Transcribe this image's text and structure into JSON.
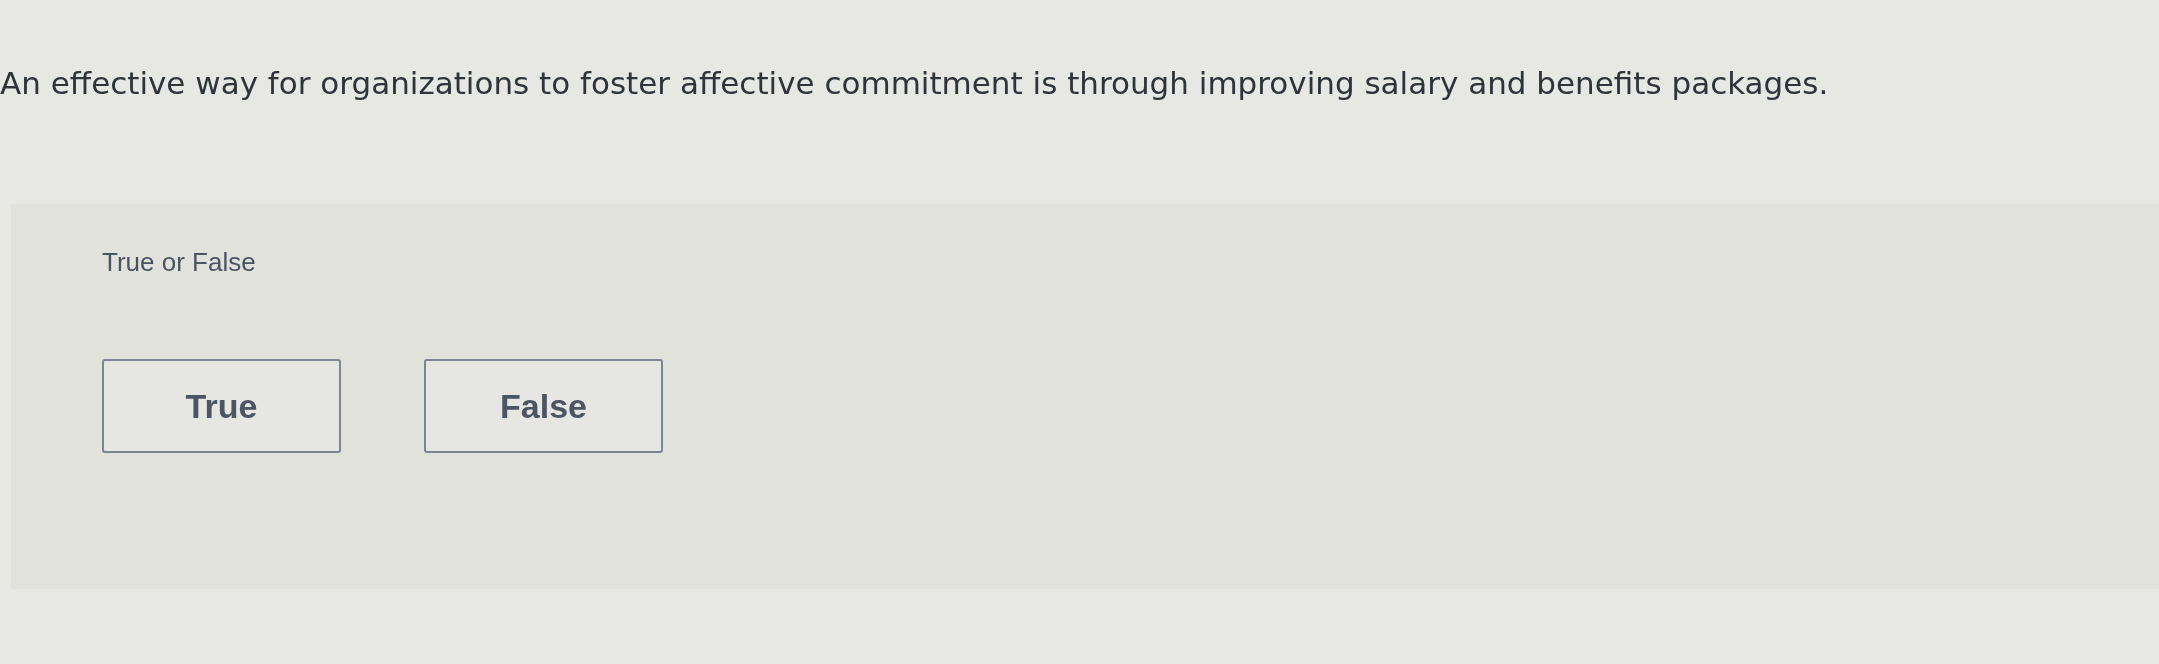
{
  "question": {
    "text": "An effective way for organizations to foster affective commitment is through improving salary and benefits packages."
  },
  "answer_panel": {
    "prompt": "True or False",
    "options": [
      {
        "label": "True",
        "selected": false
      },
      {
        "label": "False",
        "selected": false
      }
    ]
  }
}
